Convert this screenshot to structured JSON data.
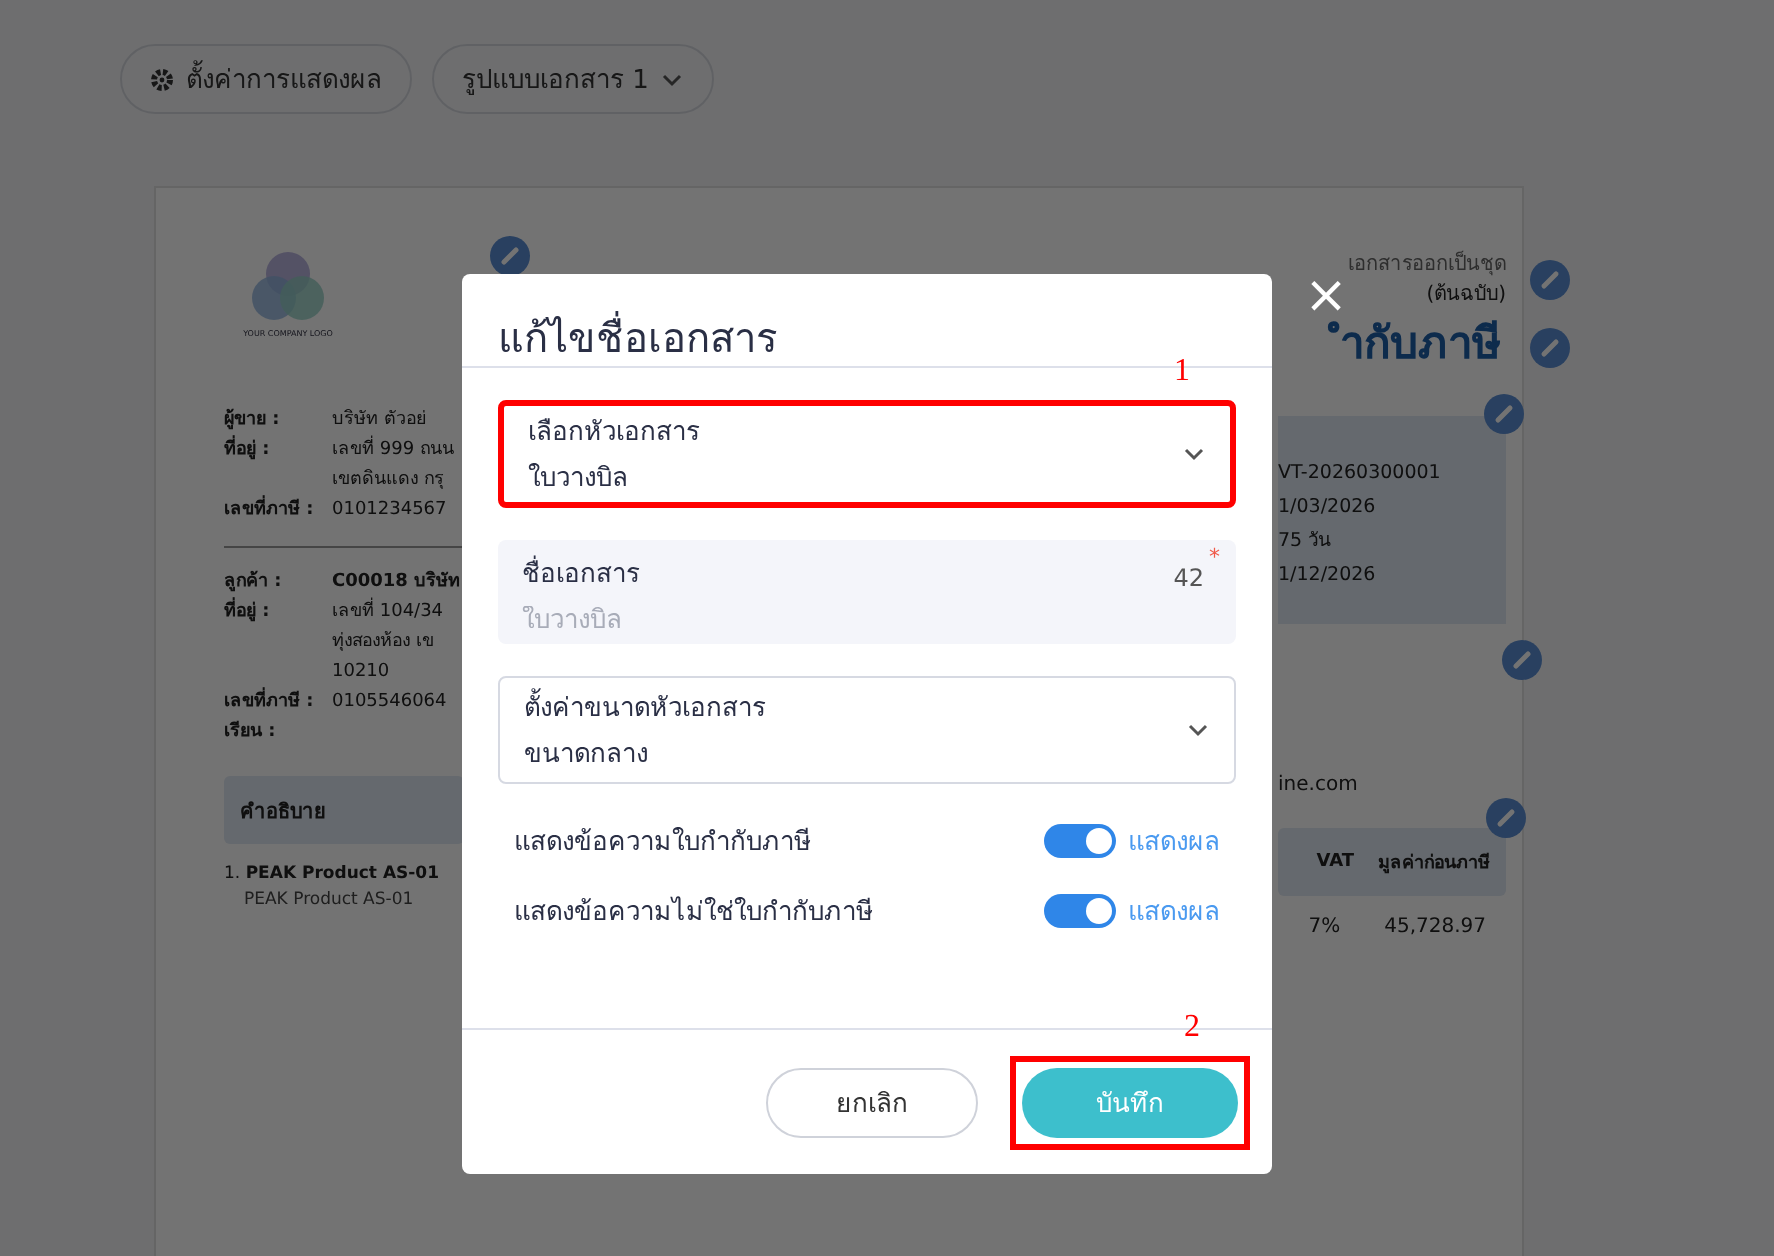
{
  "toolbar": {
    "display_button": "ตั้งค่าการแสดงผล",
    "template_select": "รูปแบบเอกสาร 1"
  },
  "document": {
    "logo_text": "YOUR COMPANY LOGO",
    "seller": [
      {
        "label": "ผู้ขาย :",
        "lines": [
          "บริษัท ตัวอย่"
        ]
      },
      {
        "label": "ที่อยู่ :",
        "lines": [
          "เลขที่ 999 ถนน",
          "เขตดินแดง กรุ"
        ]
      },
      {
        "label": "เลขที่ภาษี :",
        "lines": [
          "0101234567"
        ]
      }
    ],
    "customer": [
      {
        "label": "ลูกค้า :",
        "lines": [
          "C00018 บริษัท"
        ]
      },
      {
        "label": "ที่อยู่ :",
        "lines": [
          "เลขที่ 104/34",
          "ทุ่งสองห้อง เข",
          "10210"
        ]
      },
      {
        "label": "เลขที่ภาษี :",
        "lines": [
          "0105546064"
        ]
      },
      {
        "label": "เรียน :"
      }
    ],
    "copy_note": "เอกสารออกเป็นชุด",
    "copy_type": "(ต้นฉบับ)",
    "title": "ำกับภาษี",
    "info": [
      "VT-20260300001",
      "1/03/2026",
      "75 วัน",
      "1/12/2026"
    ],
    "contact": "ine.com",
    "table": {
      "column_1": "คำอธิบาย",
      "vat": "VAT",
      "amount": "มูลค่าก่อนภาษี",
      "rows": [
        {
          "index": "1.",
          "name": "PEAK Product AS-01",
          "detail": "PEAK Product AS-01",
          "vat": "7%",
          "amount": "45,728.97"
        }
      ]
    }
  },
  "dialog": {
    "title": "แก้ไขชื่อเอกสาร",
    "close": "×",
    "header_select": {
      "label": "เลือกหัวเอกสาร",
      "value": "ใบวางบิล",
      "annotation": "1"
    },
    "name_field": {
      "label": "ชื่อเอกสาร",
      "placeholder": "ใบวางบิล",
      "counter": "42",
      "required": "*"
    },
    "size_select": {
      "label": "ตั้งค่าขนาดหัวเอกสาร",
      "value": "ขนาดกลาง"
    },
    "toggles": [
      {
        "label": "แสดงข้อความใบกำกับภาษี",
        "on": true,
        "state_label": "แสดงผล"
      },
      {
        "label": "แสดงข้อความไม่ใช่ใบกำกับภาษี",
        "on": true,
        "state_label": "แสดงผล"
      }
    ],
    "cancel": "ยกเลิก",
    "save": "บันทึก",
    "save_annotation": "2"
  }
}
